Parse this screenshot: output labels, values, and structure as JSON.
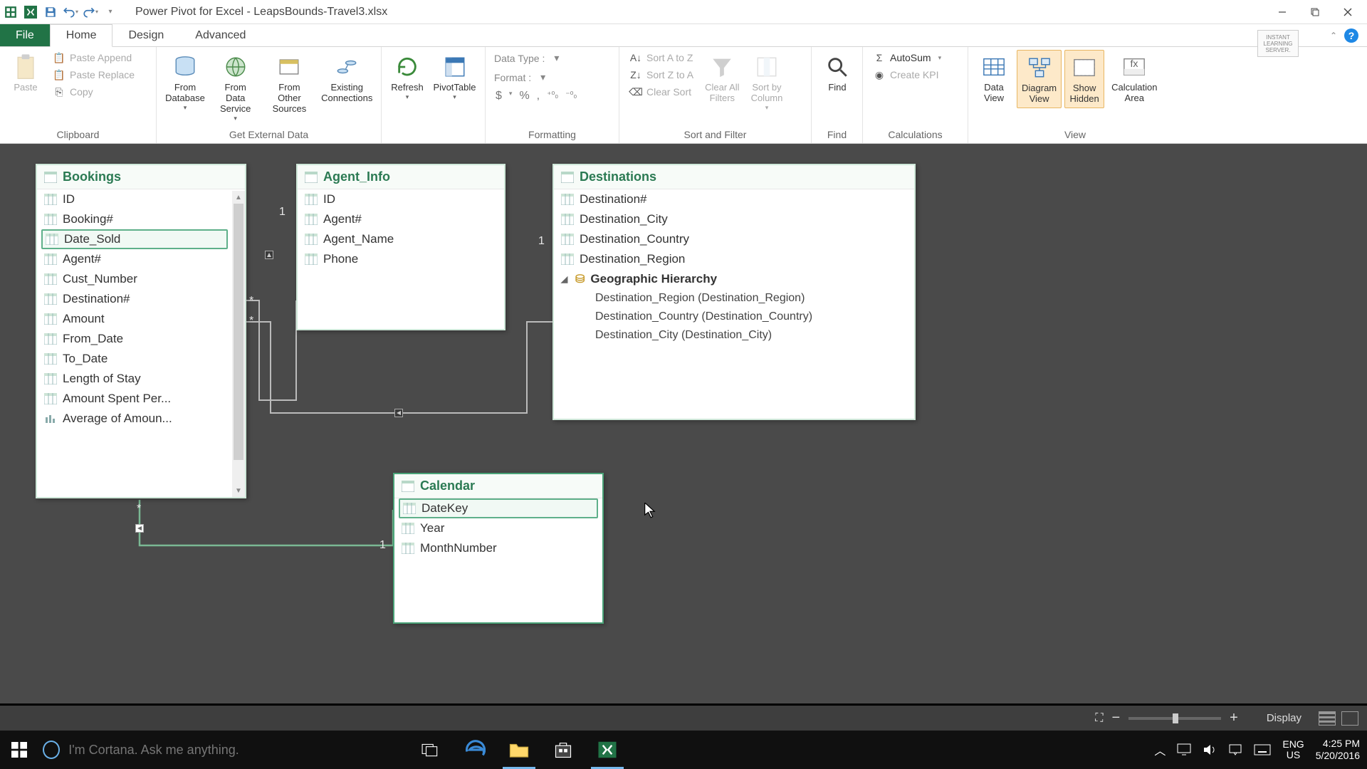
{
  "title": "Power Pivot for Excel - LeapsBounds-Travel3.xlsx",
  "tabs": {
    "file": "File",
    "home": "Home",
    "design": "Design",
    "advanced": "Advanced"
  },
  "instant_badge": {
    "l1": "INSTANT",
    "l2": "LEARNING",
    "l3": "SERVER."
  },
  "ribbon": {
    "clipboard": {
      "label": "Clipboard",
      "paste": "Paste",
      "paste_append": "Paste Append",
      "paste_replace": "Paste Replace",
      "copy": "Copy"
    },
    "getdata": {
      "label": "Get External Data",
      "from_db": "From\nDatabase",
      "from_ds": "From Data\nService",
      "from_other": "From Other\nSources",
      "existing": "Existing\nConnections"
    },
    "refresh": "Refresh",
    "pivot": "PivotTable",
    "formatting": {
      "label": "Formatting",
      "datatype": "Data Type :",
      "format": "Format :",
      "sym_currency": "$",
      "sym_percent": "%",
      "sym_comma": ",",
      "sym_inc": ".00→0",
      "sym_dec": "0→.00"
    },
    "sortfilter": {
      "label": "Sort and Filter",
      "az": "Sort A to Z",
      "za": "Sort Z to A",
      "clear_sort": "Clear Sort",
      "clear_filters": "Clear All\nFilters",
      "sort_col": "Sort by\nColumn"
    },
    "find": {
      "label": "Find",
      "btn": "Find"
    },
    "calc": {
      "label": "Calculations",
      "autosum": "AutoSum",
      "kpi": "Create KPI"
    },
    "view": {
      "label": "View",
      "data": "Data\nView",
      "diagram": "Diagram\nView",
      "hidden": "Show\nHidden",
      "calcarea": "Calculation\nArea"
    }
  },
  "tables": {
    "bookings": {
      "title": "Bookings",
      "fields": [
        "ID",
        "Booking#",
        "Date_Sold",
        "Agent#",
        "Cust_Number",
        "Destination#",
        "Amount",
        "From_Date",
        "To_Date",
        "Length of Stay",
        "Amount Spent Per...",
        "Average of Amoun..."
      ]
    },
    "agent": {
      "title": "Agent_Info",
      "fields": [
        "ID",
        "Agent#",
        "Agent_Name",
        "Phone"
      ]
    },
    "dest": {
      "title": "Destinations",
      "fields": [
        "Destination#",
        "Destination_City",
        "Destination_Country",
        "Destination_Region"
      ],
      "hierarchy": {
        "name": "Geographic Hierarchy",
        "levels": [
          "Destination_Region (Destination_Region)",
          "Destination_Country (Destination_Country)",
          "Destination_City (Destination_City)"
        ]
      }
    },
    "calendar": {
      "title": "Calendar",
      "fields": [
        "DateKey",
        "Year",
        "MonthNumber"
      ]
    }
  },
  "rel": {
    "one": "1",
    "many": "*"
  },
  "status": {
    "display": "Display"
  },
  "taskbar": {
    "search_placeholder": "I'm Cortana. Ask me anything.",
    "lang1": "ENG",
    "lang2": "US",
    "time": "4:25 PM",
    "date": "5/20/2016"
  }
}
